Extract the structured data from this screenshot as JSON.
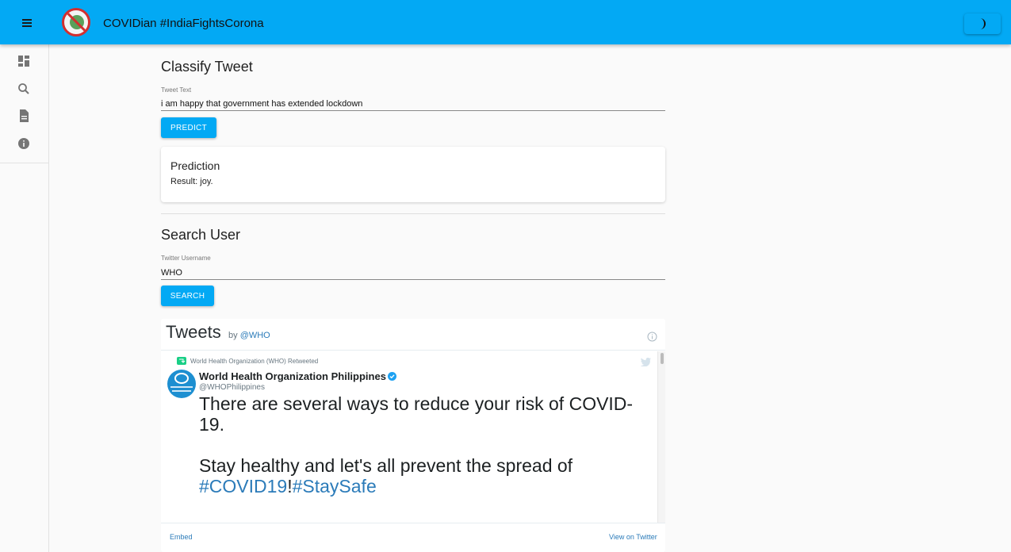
{
  "appbar": {
    "title": "COVIDian #IndiaFightsCorona"
  },
  "sidebar": {
    "items": [
      {
        "icon": "dashboard-icon"
      },
      {
        "icon": "search-icon"
      },
      {
        "icon": "document-icon"
      },
      {
        "icon": "info-icon"
      }
    ]
  },
  "classify": {
    "title": "Classify Tweet",
    "field_label": "Tweet Text",
    "field_value": "i am happy that government has extended lockdown",
    "button_label": "PREDICT"
  },
  "prediction": {
    "title": "Prediction",
    "result": "Result: joy."
  },
  "search": {
    "title": "Search User",
    "field_label": "Twitter Username",
    "field_value": "WHO",
    "button_label": "SEARCH"
  },
  "timeline": {
    "title": "Tweets",
    "by": "by",
    "handle": "@WHO",
    "tweet": {
      "retweet_note": "World Health Organization (WHO) Retweeted",
      "author_name": "World Health Organization Philippines",
      "author_handle": "@WHOPhilippines",
      "text": "There are several ways to reduce your risk of COVID-19.\n\nStay healthy and let's all prevent the spread of ",
      "hashtag1": "#COVID19",
      "separator": "!",
      "hashtag2": "#StaySafe"
    },
    "footer": {
      "embed": "Embed",
      "view": "View on Twitter"
    }
  },
  "colors": {
    "primary": "#03a9f4",
    "twitter_link": "#2b7bb9"
  }
}
